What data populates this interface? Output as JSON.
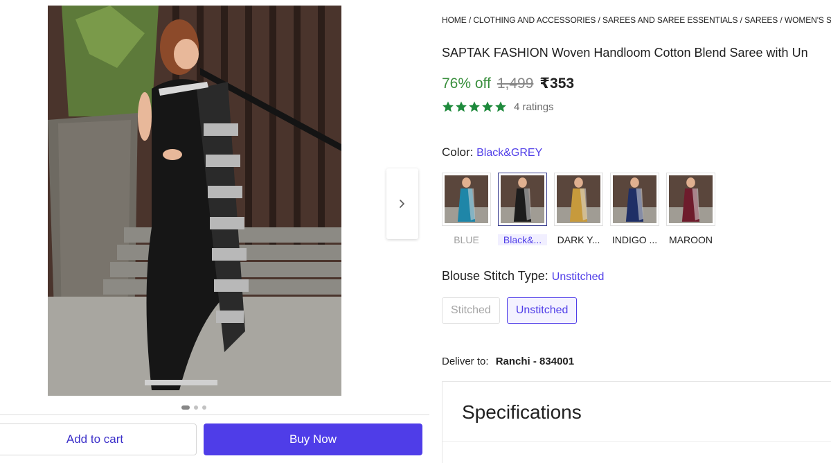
{
  "breadcrumb": {
    "items": [
      "HOME",
      "CLOTHING AND ACCESSORIES",
      "SAREES AND SAREE ESSENTIALS",
      "SAREES",
      "WOMEN'S SAR"
    ],
    "separator": "/"
  },
  "product": {
    "title": "SAPTAK FASHION Woven Handloom Cotton Blend Saree with Un",
    "discount": "76% off",
    "mrp": "1,499",
    "price": "₹353",
    "rating_count": "4 ratings",
    "rating_stars": 5
  },
  "color": {
    "label": "Color:",
    "selected": "Black&GREY",
    "options": [
      {
        "name": "BLUE",
        "state": "disabled",
        "saree_color": "#1f86a8"
      },
      {
        "name": "Black&...",
        "state": "selected",
        "saree_color": "#1c1c1c"
      },
      {
        "name": "DARK Y...",
        "state": "normal",
        "saree_color": "#c79a3c"
      },
      {
        "name": "INDIGO ...",
        "state": "normal",
        "saree_color": "#1f2f66"
      },
      {
        "name": "MAROON",
        "state": "normal",
        "saree_color": "#6e1c2c"
      }
    ]
  },
  "blouse": {
    "label": "Blouse Stitch Type:",
    "selected": "Unstitched",
    "options": [
      {
        "name": "Stitched",
        "state": "disabled"
      },
      {
        "name": "Unstitched",
        "state": "selected"
      }
    ]
  },
  "delivery": {
    "label": "Deliver to:",
    "location": "Ranchi - 834001"
  },
  "specs": {
    "title": "Specifications"
  },
  "actions": {
    "add_to_cart": "Add to cart",
    "buy_now": "Buy Now"
  },
  "gallery": {
    "total_images": 3,
    "active_index": 0
  },
  "colors": {
    "accent": "#4f3de8",
    "discount_green": "#388e3c",
    "star_green": "#1e8a3c"
  }
}
